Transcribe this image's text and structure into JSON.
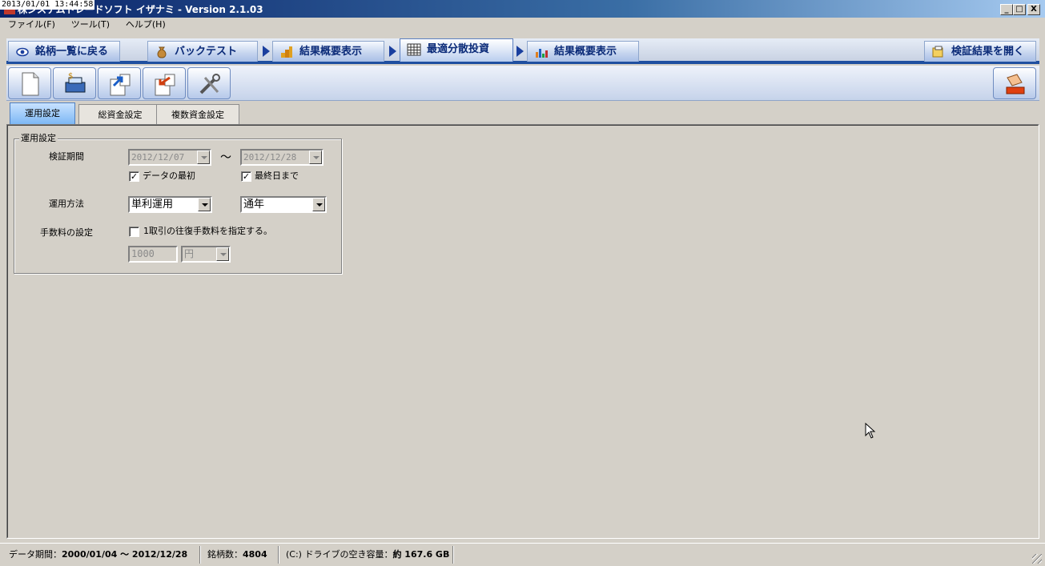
{
  "clock": "2013/01/01 13:44:58",
  "window": {
    "title": "株システムトレードソフト イザナミ - Version 2.1.03",
    "controls": {
      "minimize": "_",
      "maximize": "□",
      "close": "X"
    }
  },
  "menu": {
    "items": [
      "ファイル(F)",
      "ツール(T)",
      "ヘルプ(H)"
    ]
  },
  "nav": {
    "tabs": [
      {
        "label": "銘柄一覧に戻る",
        "icon": "eye-icon"
      },
      {
        "label": "バックテスト",
        "icon": "money-bag-icon"
      },
      {
        "label": "結果概要表示",
        "icon": "coins-icon"
      },
      {
        "label": "最適分散投資",
        "icon": "grid-icon",
        "active": true
      },
      {
        "label": "結果概要表示",
        "icon": "bar-chart-icon"
      }
    ],
    "open_results": "検証結果を開く"
  },
  "toolbar": {
    "buttons": [
      "new-document",
      "cash-register",
      "export",
      "import",
      "tools"
    ]
  },
  "subtabs": [
    {
      "label": "運用設定",
      "active": true
    },
    {
      "label": "総資金設定"
    },
    {
      "label": "複数資金設定"
    }
  ],
  "settings": {
    "group_title": "運用設定",
    "period_label": "検証期間",
    "start_date": "2012/12/07",
    "end_date": "2012/12/28",
    "tilde": "～",
    "start_check_label": "データの最初",
    "start_checked": true,
    "end_check_label": "最終日まで",
    "end_checked": true,
    "method_label": "運用方法",
    "method_value": "単利運用",
    "term_value": "通年",
    "fee_label": "手数料の設定",
    "fee_check_label": "1取引の往復手数料を指定する。",
    "fee_checked": false,
    "fee_amount": "1000",
    "fee_unit": "円"
  },
  "status": {
    "data_period_label": "データ期間：",
    "data_period_value": "2000/01/04 ～ 2012/12/28",
    "stock_count_label": "銘柄数：",
    "stock_count_value": "4804",
    "drive_label": "(C:) ドライブの空き容量：",
    "drive_value": "約 167.6 GB"
  },
  "colors": {
    "nav_text": "#0a2a78",
    "nav_underline": "#1f4fa0",
    "active_subtab": "#7ab6f4",
    "window_bg": "#d4d0c8"
  }
}
